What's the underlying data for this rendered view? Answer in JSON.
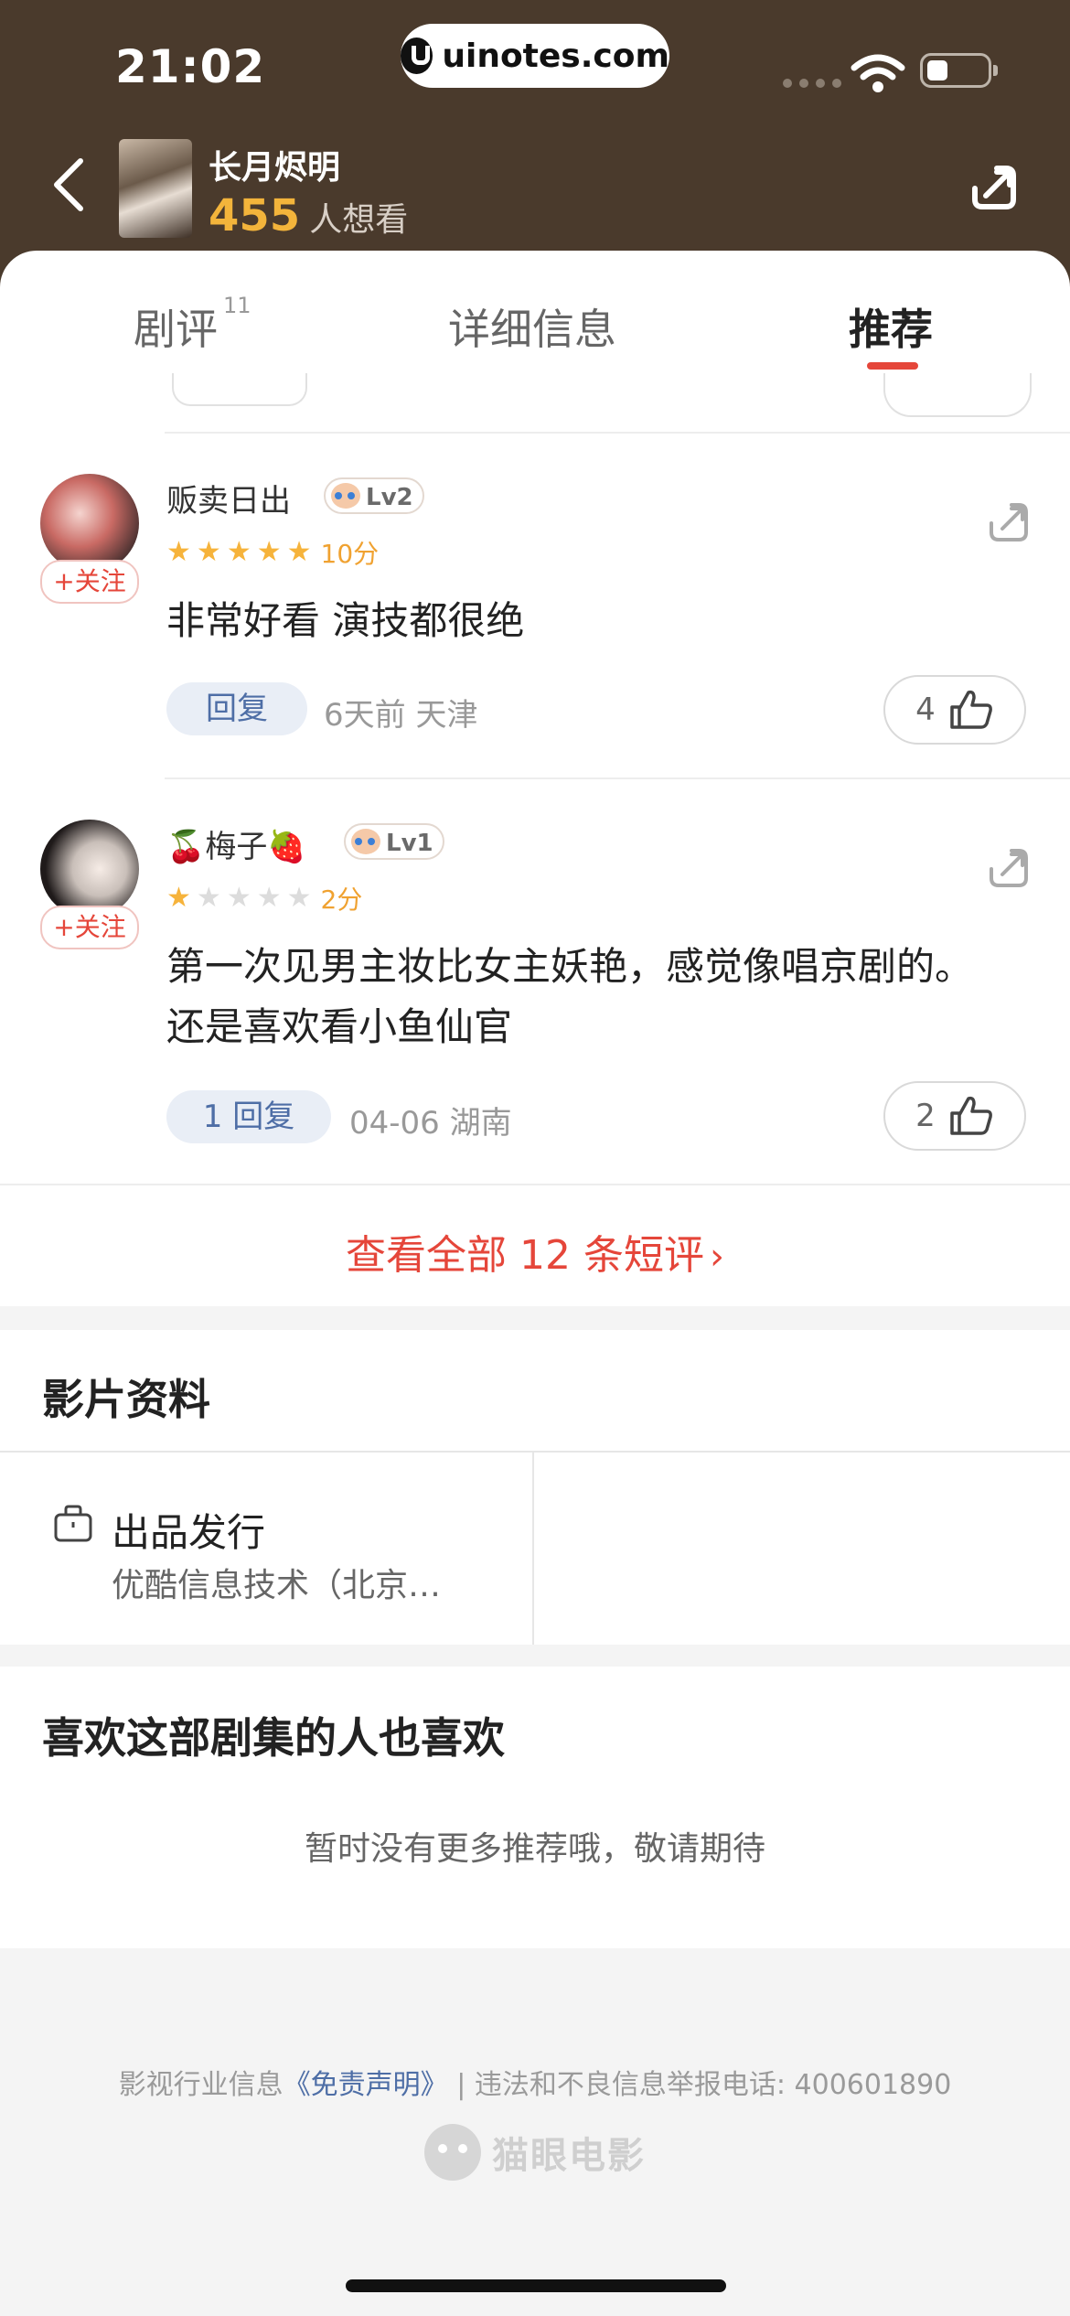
{
  "status_bar": {
    "time": "21:02",
    "url": "uinotes.com"
  },
  "header": {
    "title": "长月烬明",
    "want_count": "455",
    "want_label": "人想看"
  },
  "tabs": [
    {
      "label": "剧评",
      "count": "11"
    },
    {
      "label": "详细信息"
    },
    {
      "label": "推荐"
    }
  ],
  "comments": [
    {
      "user": "贩卖日出",
      "level": "Lv2",
      "score": "10分",
      "stars": 5,
      "text": "非常好看 演技都很绝",
      "reply_label": "回复",
      "meta": "6天前 天津",
      "likes": "4",
      "follow_label": "+关注"
    },
    {
      "user": "🍒梅子🍓",
      "level": "Lv1",
      "score": "2分",
      "stars": 1,
      "text": "第一次见男主妆比女主妖艳，感觉像唱京剧的。还是喜欢看小鱼仙官",
      "reply_label": "1 回复",
      "meta": "04-06 湖南",
      "likes": "2",
      "follow_label": "+关注"
    }
  ],
  "view_all": "查看全部 12 条短评",
  "film_info": {
    "title": "影片资料",
    "label": "出品发行",
    "value": "优酷信息技术（北京…"
  },
  "recommend": {
    "title": "喜欢这部剧集的人也喜欢",
    "empty": "暂时没有更多推荐哦，敬请期待"
  },
  "footer": {
    "prefix": "影视行业信息",
    "link": "《免责声明》",
    "suffix": "| 违法和不良信息举报电话: 400601890",
    "brand": "猫眼电影"
  },
  "colors": {
    "accent": "#e5463a",
    "header_bg": "#4a3a2c",
    "star": "#f6b33b",
    "want": "#f3b43b"
  }
}
